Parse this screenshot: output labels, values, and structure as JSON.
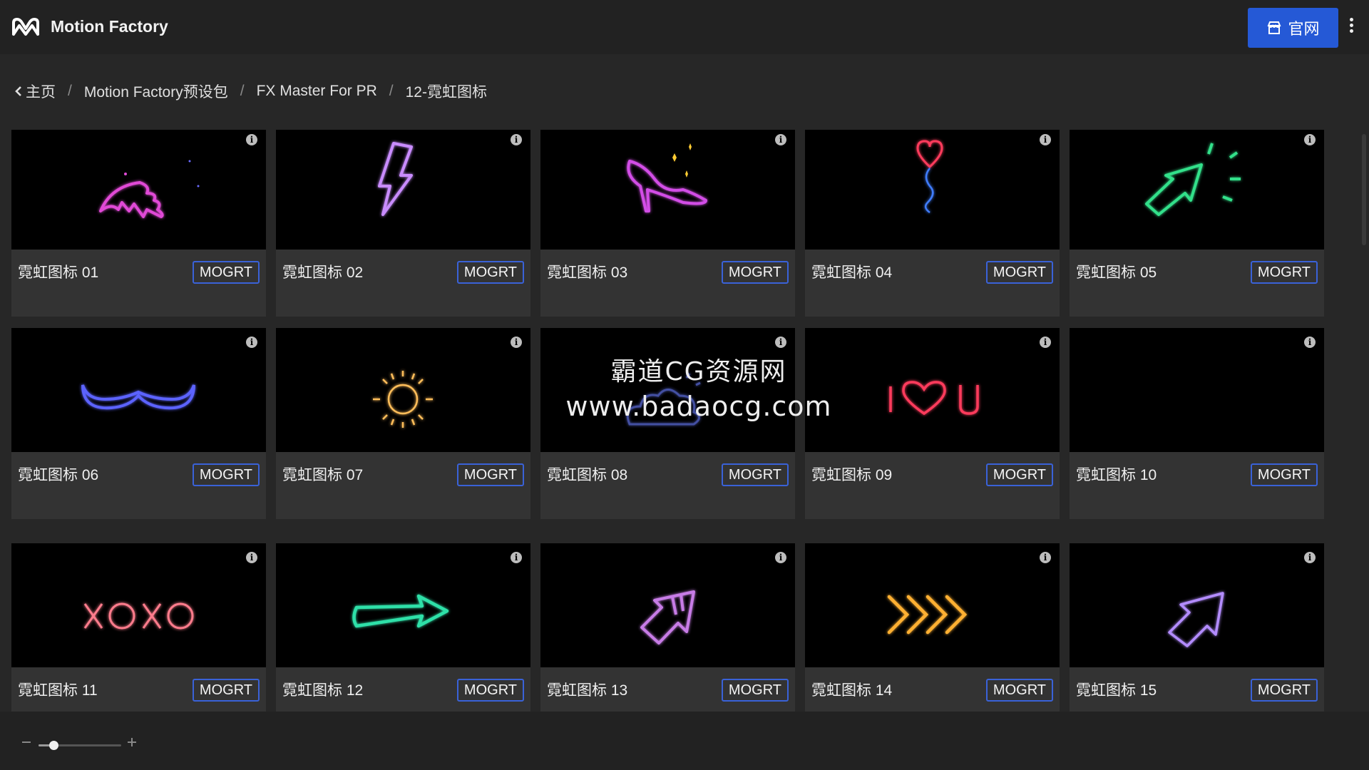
{
  "app": {
    "title": "Motion Factory"
  },
  "header": {
    "site_button_label": "官网"
  },
  "breadcrumb": [
    "主页",
    "Motion Factory预设包",
    "FX Master For PR",
    "12-霓虹图标"
  ],
  "cards": [
    {
      "name": "霓虹图标 01",
      "tag": "MOGRT",
      "icon": "neon-wing"
    },
    {
      "name": "霓虹图标 02",
      "tag": "MOGRT",
      "icon": "neon-lightning"
    },
    {
      "name": "霓虹图标 03",
      "tag": "MOGRT",
      "icon": "neon-high-heel"
    },
    {
      "name": "霓虹图标 04",
      "tag": "MOGRT",
      "icon": "neon-heart-balloon"
    },
    {
      "name": "霓虹图标 05",
      "tag": "MOGRT",
      "icon": "neon-arrow-burst"
    },
    {
      "name": "霓虹图标 06",
      "tag": "MOGRT",
      "icon": "neon-mustache"
    },
    {
      "name": "霓虹图标 07",
      "tag": "MOGRT",
      "icon": "neon-sun"
    },
    {
      "name": "霓虹图标 08",
      "tag": "MOGRT",
      "icon": "neon-cloud"
    },
    {
      "name": "霓虹图标 09",
      "tag": "MOGRT",
      "icon": "neon-i-heart-u"
    },
    {
      "name": "霓虹图标 10",
      "tag": "MOGRT",
      "icon": "empty"
    },
    {
      "name": "霓虹图标 11",
      "tag": "MOGRT",
      "icon": "neon-xoxo"
    },
    {
      "name": "霓虹图标 12",
      "tag": "MOGRT",
      "icon": "neon-arrow-right"
    },
    {
      "name": "霓虹图标 13",
      "tag": "MOGRT",
      "icon": "neon-arrow-up-right-pink"
    },
    {
      "name": "霓虹图标 14",
      "tag": "MOGRT",
      "icon": "neon-chevrons"
    },
    {
      "name": "霓虹图标 15",
      "tag": "MOGRT",
      "icon": "neon-arrow-up-right-purple"
    }
  ],
  "watermark": {
    "line1": "霸道CG资源网",
    "line2": "www.badaocg.com"
  },
  "zoom": {
    "level": 0.18
  },
  "colors": {
    "accent": "#2559d6",
    "tag_border": "#3a62d8",
    "card_bg": "#333333",
    "app_bg": "#272727"
  }
}
